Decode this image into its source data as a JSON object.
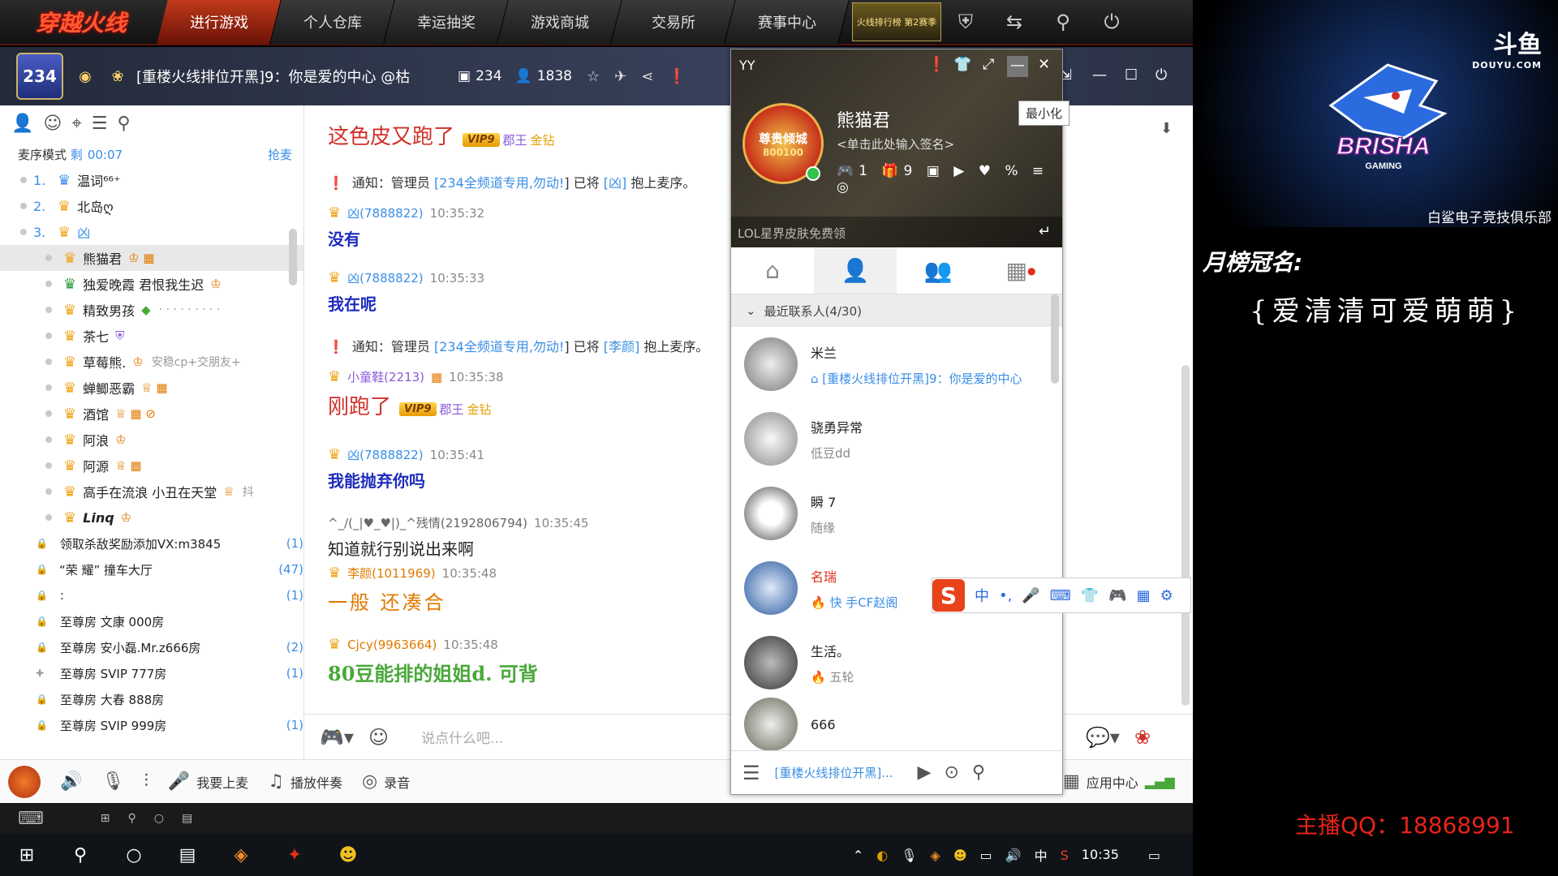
{
  "game_bar": {
    "logo": "穿越火线",
    "tabs": [
      "进行游戏",
      "个人仓库",
      "幸运抽奖",
      "游戏商城",
      "交易所",
      "赛事中心"
    ],
    "active_tab": "进行游戏",
    "rank_badge": "火线排行榜 第2赛季"
  },
  "yy_header": {
    "channel_id": "234",
    "channel_title": "[重楼火线排位开黑]9：你是爱的中心 @枯",
    "stat_rooms": "234",
    "stat_users": "1838"
  },
  "left_panel": {
    "mic_mode_label": "麦序模式",
    "mic_remaining_label": "剩",
    "mic_timer": "00:07",
    "grab_mic": "抢麦",
    "queue": [
      {
        "num": "1.",
        "name": "温词⁶⁶⁺"
      },
      {
        "num": "2.",
        "name": "北岛ღ"
      },
      {
        "num": "3.",
        "name": "凶"
      }
    ],
    "users": [
      {
        "name": "熊猫君",
        "sub": ""
      },
      {
        "name": "独爱晚霞 君恨我生迟",
        "sub": ""
      },
      {
        "name": "精致男孩",
        "sub": "· · · · · · · · ·"
      },
      {
        "name": "茶七",
        "sub": ""
      },
      {
        "name": "草莓熊.",
        "sub": "安稳cp+交朋友+"
      },
      {
        "name": "蝉鲫恶霸",
        "sub": ""
      },
      {
        "name": "酒馆",
        "sub": ""
      },
      {
        "name": "阿浪",
        "sub": ""
      },
      {
        "name": "阿源",
        "sub": ""
      },
      {
        "name": "高手在流浪 小丑在天堂",
        "sub": "抖"
      },
      {
        "name": "Linq",
        "sub": ""
      }
    ],
    "rooms": [
      {
        "name": "领取杀敌奖励添加VX:m3845",
        "count": "(1)"
      },
      {
        "name": "“荣  耀” 撞车大厅",
        "count": "(47)"
      },
      {
        "name": ":",
        "count": "(1)"
      },
      {
        "name": "至尊房    文康     000房",
        "count": ""
      },
      {
        "name": "至尊房 安小磊.Mr.z666房",
        "count": "(2)"
      },
      {
        "name": "至尊房    SVIP     777房",
        "count": "(1)"
      },
      {
        "name": "至尊房    大春     888房",
        "count": ""
      },
      {
        "name": "至尊房    SVIP     999房",
        "count": "(1)"
      }
    ]
  },
  "chat": {
    "messages": [
      {
        "kind": "big",
        "body": "这色皮又跑了",
        "vip": "VIP9",
        "title": "郡王",
        "level": "金钻"
      },
      {
        "kind": "notice",
        "text_a": "通知：管理员",
        "link_a": "[234全频道专用,勿动!",
        "text_b": "] 已将",
        "link_b": "[凶]",
        "text_c": "抱上麦序。"
      },
      {
        "kind": "normal",
        "nick": "凶(7888822)",
        "time": "10:35:32",
        "body": "没有"
      },
      {
        "kind": "normal",
        "nick": "凶(7888822)",
        "time": "10:35:33",
        "body": "我在呢"
      },
      {
        "kind": "notice",
        "text_a": "通知：管理员",
        "link_a": "[234全频道专用,勿动!",
        "text_b": "] 已将",
        "link_b": "[李颜]",
        "text_c": "抱上麦序。"
      },
      {
        "kind": "big",
        "nick": "小童鞋(2213)",
        "time": "10:35:38",
        "body": "刚跑了",
        "vip": "VIP9",
        "title": "郡王",
        "level": "金钻"
      },
      {
        "kind": "normal",
        "nick": "凶(7888822)",
        "time": "10:35:41",
        "body": "我能抛弃你吗"
      },
      {
        "kind": "plain",
        "nick": "^_/(_|♥_♥|)_^残情(2192806794)",
        "time": "10:35:45",
        "body": "知道就行别说出来啊"
      },
      {
        "kind": "orange",
        "nick": "李颜(1011969)",
        "time": "10:35:48",
        "body": "一般 还凑合"
      },
      {
        "kind": "green",
        "nick": "Cjcy(9963664)",
        "time": "10:35:48",
        "body": "80豆能排的姐姐d. 可背"
      }
    ],
    "input_placeholder": "说点什么吧..."
  },
  "bottom_bar": {
    "items": [
      "我要上麦",
      "播放伴奏",
      "录音"
    ],
    "app_center": "应用中心"
  },
  "popup": {
    "title": "YY",
    "tooltip": "最小化",
    "profile_name": "熊猫君",
    "signature": "<单击此处输入签名>",
    "badges": "🎮1 🎁9 ▣ ▶ ♥ % ≡ ◎",
    "avatar_title": "尊贵倾城",
    "avatar_id": "800100",
    "banner": "LOL星界皮肤免费领",
    "group_label": "最近联系人(4/30)",
    "contacts": [
      {
        "name": "米兰",
        "status": "[重楼火线排位开黑]9：你是爱的中心",
        "status_is_link": true
      },
      {
        "name": "骁勇异常",
        "status": "低豆dd",
        "status_is_link": false
      },
      {
        "name": "瞬 7",
        "status": "随缘",
        "status_is_link": false
      },
      {
        "name": "名瑞",
        "status": "快 手CF赵阁",
        "status_is_link": true
      },
      {
        "name": "生活。",
        "status": "五轮",
        "status_is_link": false
      },
      {
        "name": "666",
        "status": "",
        "status_is_link": false
      }
    ],
    "bottom_link": "[重楼火线排位开黑]..."
  },
  "ime": {
    "logo": "S",
    "items": [
      "中",
      "•,",
      "🎤",
      "⌨",
      "👕",
      "🎮",
      "▦",
      "⚙"
    ]
  },
  "taskbar": {
    "time": "10:35",
    "tray_lang": "中"
  },
  "overlay": {
    "brand": "斗鱼",
    "brand_sub": "DOUYU.COM",
    "logo_text": "BRISHA",
    "logo_sub": "GAMING",
    "club_name": "白鲨电子竞技俱乐部",
    "champ_label": "月榜冠名:",
    "champ_name": "{爱清清可爱萌萌}",
    "streamer_qq": "主播QQ：18868991"
  }
}
